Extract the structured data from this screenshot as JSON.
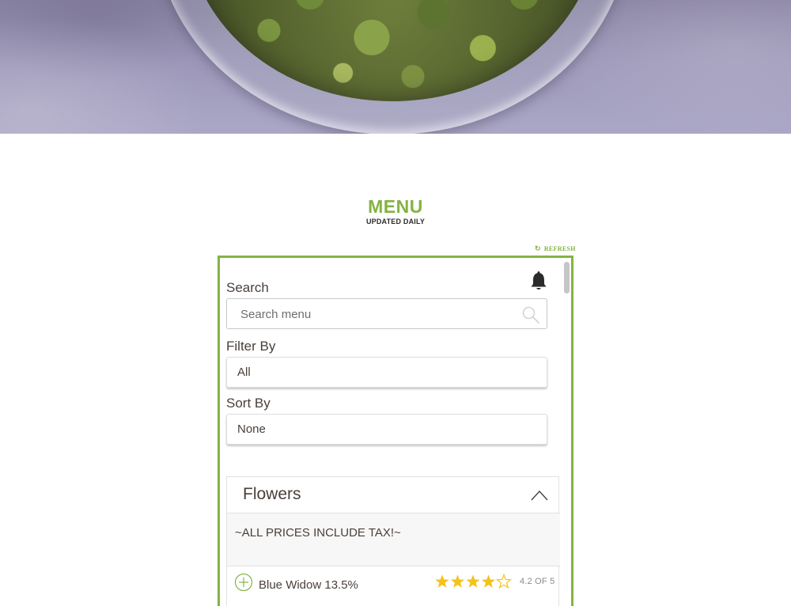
{
  "header": {
    "title": "MENU",
    "subtitle": "UPDATED DAILY",
    "refresh_label": "REFRESH",
    "accent_color": "#84b342"
  },
  "icons": {
    "refresh": "refresh-icon",
    "notifications": "bell-icon",
    "search": "search-icon",
    "collapse": "chevron-up-icon",
    "add": "plus-circle-icon",
    "rating": "star-icon"
  },
  "controls": {
    "search": {
      "label": "Search",
      "placeholder": "Search menu",
      "value": ""
    },
    "filter": {
      "label": "Filter By",
      "selected": "All"
    },
    "sort": {
      "label": "Sort By",
      "selected": "None"
    }
  },
  "sections": [
    {
      "title": "Flowers",
      "expanded": true,
      "notice": "~ALL PRICES INCLUDE TAX!~",
      "items": [
        {
          "name": "Blue Widow 13.5%",
          "rating": 4.2,
          "rating_max": 5,
          "rating_label": "4.2 OF 5"
        }
      ]
    }
  ]
}
